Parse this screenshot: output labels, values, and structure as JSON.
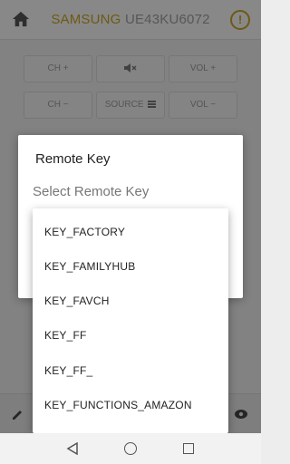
{
  "header": {
    "brand": "SAMSUNG",
    "model": "UE43KU6072",
    "info_glyph": "!"
  },
  "remote": {
    "row1": {
      "ch_up": "CH +",
      "vol_up": "VOL +"
    },
    "row2": {
      "ch_down": "CH −",
      "source": "SOURCE",
      "vol_down": "VOL −"
    }
  },
  "dialog": {
    "title": "Remote Key",
    "select_placeholder": "Select Remote Key"
  },
  "dropdown": {
    "options": [
      "KEY_FACTORY",
      "KEY_FAMILYHUB",
      "KEY_FAVCH",
      "KEY_FF",
      "KEY_FF_",
      "KEY_FUNCTIONS_AMAZON"
    ]
  },
  "colors": {
    "brand": "#c9a227",
    "overlay": "rgba(0,0,0,0.45)"
  },
  "icons": [
    "home-icon",
    "info-icon",
    "mute-icon",
    "menu-icon",
    "pencil-icon",
    "eye-icon",
    "nav-back-icon",
    "nav-home-icon",
    "nav-recents-icon"
  ]
}
